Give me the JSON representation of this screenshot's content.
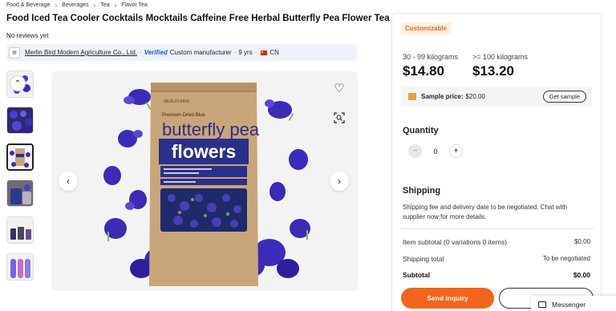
{
  "breadcrumb": [
    "Food & Beverage",
    "Beverages",
    "Tea",
    "Flavor Tea"
  ],
  "title": "Food Iced Tea Cooler Cocktails Mocktails Caffeine Free Herbal Butterfly Pea Flower Tea",
  "reviews": "No reviews yet",
  "supplier": {
    "name": "Merlin Bird Modern Agriculture Co., Ltd.",
    "verified": "Verified",
    "type": "Custom manufacturer",
    "years": "9 yrs",
    "country": "CN"
  },
  "product_image": {
    "small_top": "Premium Dried Blue",
    "headline_1": "butterfly pea",
    "headline_2": "flowers"
  },
  "pricing": {
    "badge": "Customizable",
    "tiers": [
      {
        "qty": "30 - 99 kilograms",
        "price": "$14.80"
      },
      {
        "qty": ">= 100 kilograms",
        "price": "$13.20"
      }
    ],
    "sample_label": "Sample price:",
    "sample_price": "$20.00",
    "sample_button": "Get sample"
  },
  "quantity": {
    "label": "Quantity",
    "value": "0"
  },
  "shipping": {
    "label": "Shipping",
    "text": "Shipping fee and delivery date to be negotiated. Chat with supplier now for more details."
  },
  "summary": {
    "item_subtotal_label": "Item subtotal (0 variations 0 items)",
    "item_subtotal_value": "$0.00",
    "shipping_total_label": "Shipping total",
    "shipping_total_value": "To be negotiated",
    "subtotal_label": "Subtotal",
    "subtotal_value": "$0.00"
  },
  "actions": {
    "send_inquiry": "Send inquiry"
  },
  "messenger": "Messenger",
  "colors": {
    "accent": "#f4641b",
    "flower": "#3b2bb8",
    "bag": "#c9a57a"
  }
}
